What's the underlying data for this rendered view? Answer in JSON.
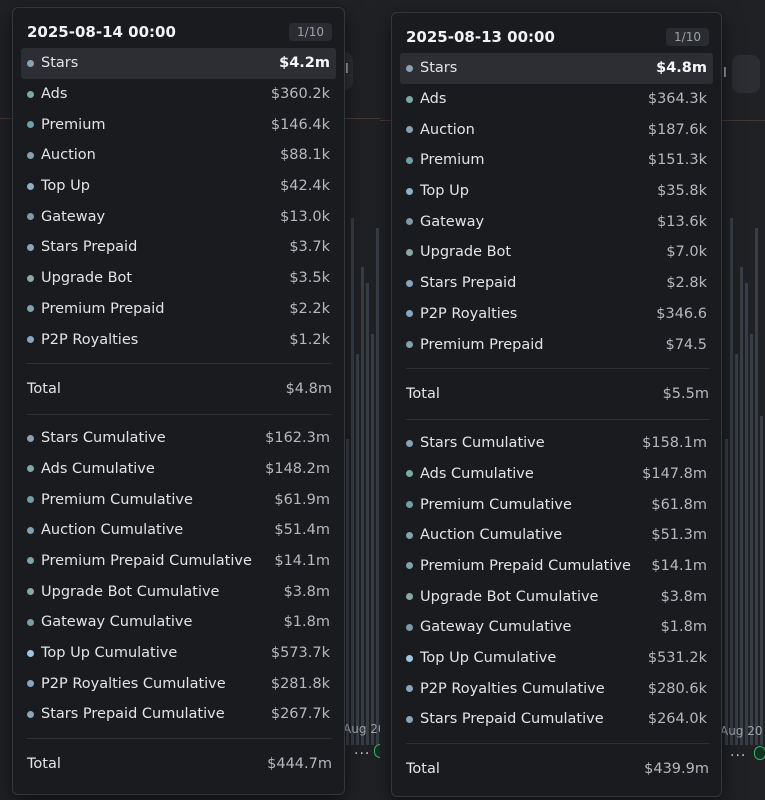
{
  "background": {
    "date_label": "Aug 20",
    "toolbar_glyph": "I",
    "more_glyph": "...",
    "colors": {
      "grid_line": "#6b4a3f",
      "bars": "#4d5563",
      "pill": "#3fae6c"
    }
  },
  "tooltips": [
    {
      "date": "2025-08-14 00:00",
      "page": "1/10",
      "items": [
        {
          "label": "Stars",
          "value": "$4.2m",
          "color": "#8aa1b4"
        },
        {
          "label": "Ads",
          "value": "$360.2k",
          "color": "#7fa7a7"
        },
        {
          "label": "Premium",
          "value": "$146.4k",
          "color": "#6fa0a8"
        },
        {
          "label": "Auction",
          "value": "$88.1k",
          "color": "#86a0b0"
        },
        {
          "label": "Top Up",
          "value": "$42.4k",
          "color": "#8fb0c4"
        },
        {
          "label": "Gateway",
          "value": "$13.0k",
          "color": "#7d9aa6"
        },
        {
          "label": "Stars Prepaid",
          "value": "$3.7k",
          "color": "#8aa4b8"
        },
        {
          "label": "Upgrade Bot",
          "value": "$3.5k",
          "color": "#8aa8a4"
        },
        {
          "label": "Premium Prepaid",
          "value": "$2.2k",
          "color": "#7fa2ac"
        },
        {
          "label": "P2P Royalties",
          "value": "$1.2k",
          "color": "#89a6c0"
        }
      ],
      "total": {
        "label": "Total",
        "value": "$4.8m"
      },
      "cumulative": [
        {
          "label": "Stars Cumulative",
          "value": "$162.3m",
          "color": "#8aa1b4"
        },
        {
          "label": "Ads Cumulative",
          "value": "$148.2m",
          "color": "#7fa7a7"
        },
        {
          "label": "Premium Cumulative",
          "value": "$61.9m",
          "color": "#6fa0a8"
        },
        {
          "label": "Auction Cumulative",
          "value": "$51.4m",
          "color": "#86a0b0"
        },
        {
          "label": "Premium Prepaid Cumulative",
          "value": "$14.1m",
          "color": "#7fa2ac"
        },
        {
          "label": "Upgrade Bot Cumulative",
          "value": "$3.8m",
          "color": "#8aa8a4"
        },
        {
          "label": "Gateway Cumulative",
          "value": "$1.8m",
          "color": "#7d9aa6"
        },
        {
          "label": "Top Up Cumulative",
          "value": "$573.7k",
          "color": "#9fc6e0"
        },
        {
          "label": "P2P Royalties Cumulative",
          "value": "$281.8k",
          "color": "#89a6c0"
        },
        {
          "label": "Stars Prepaid Cumulative",
          "value": "$267.7k",
          "color": "#8aa4b8"
        }
      ],
      "cumulative_total": {
        "label": "Total",
        "value": "$444.7m"
      }
    },
    {
      "date": "2025-08-13 00:00",
      "page": "1/10",
      "items": [
        {
          "label": "Stars",
          "value": "$4.8m",
          "color": "#8aa1b4"
        },
        {
          "label": "Ads",
          "value": "$364.3k",
          "color": "#7fa7a7"
        },
        {
          "label": "Auction",
          "value": "$187.6k",
          "color": "#86a0b0"
        },
        {
          "label": "Premium",
          "value": "$151.3k",
          "color": "#6fa0a8"
        },
        {
          "label": "Top Up",
          "value": "$35.8k",
          "color": "#8fb0c4"
        },
        {
          "label": "Gateway",
          "value": "$13.6k",
          "color": "#7d9aa6"
        },
        {
          "label": "Upgrade Bot",
          "value": "$7.0k",
          "color": "#8aa8a4"
        },
        {
          "label": "Stars Prepaid",
          "value": "$2.8k",
          "color": "#8aa4b8"
        },
        {
          "label": "P2P Royalties",
          "value": "$346.6",
          "color": "#89a6c0"
        },
        {
          "label": "Premium Prepaid",
          "value": "$74.5",
          "color": "#7fa2ac"
        }
      ],
      "total": {
        "label": "Total",
        "value": "$5.5m"
      },
      "cumulative": [
        {
          "label": "Stars Cumulative",
          "value": "$158.1m",
          "color": "#8aa1b4"
        },
        {
          "label": "Ads Cumulative",
          "value": "$147.8m",
          "color": "#7fa7a7"
        },
        {
          "label": "Premium Cumulative",
          "value": "$61.8m",
          "color": "#6fa0a8"
        },
        {
          "label": "Auction Cumulative",
          "value": "$51.3m",
          "color": "#86a0b0"
        },
        {
          "label": "Premium Prepaid Cumulative",
          "value": "$14.1m",
          "color": "#7fa2ac"
        },
        {
          "label": "Upgrade Bot Cumulative",
          "value": "$3.8m",
          "color": "#8aa8a4"
        },
        {
          "label": "Gateway Cumulative",
          "value": "$1.8m",
          "color": "#7d9aa6"
        },
        {
          "label": "Top Up Cumulative",
          "value": "$531.2k",
          "color": "#9fc6e0"
        },
        {
          "label": "P2P Royalties Cumulative",
          "value": "$280.6k",
          "color": "#89a6c0"
        },
        {
          "label": "Stars Prepaid Cumulative",
          "value": "$264.0k",
          "color": "#8aa4b8"
        }
      ],
      "cumulative_total": {
        "label": "Total",
        "value": "$439.9m"
      }
    }
  ]
}
